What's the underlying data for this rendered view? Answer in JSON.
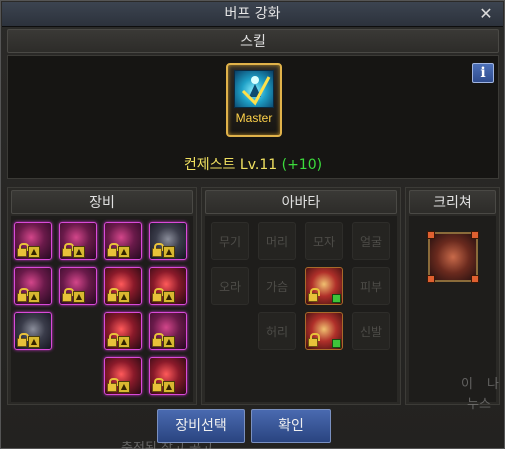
{
  "window": {
    "title": "버프 강화",
    "close_glyph": "✕"
  },
  "skill": {
    "header": "스킬",
    "info_label": "i",
    "icon_name": "buff-skill-icon",
    "badge": "Master",
    "level_text": "컨제스트 Lv.11",
    "level_bonus": "(+10)"
  },
  "equipment": {
    "header": "장비",
    "items": [
      {
        "icon": "armor-icon"
      },
      {
        "icon": "shoulder-icon"
      },
      {
        "icon": "spiked-armor-icon"
      },
      {
        "icon": "dark-armor-icon"
      },
      {
        "icon": "pants-icon"
      },
      {
        "icon": "belt-icon"
      },
      {
        "icon": "orb-icon"
      },
      {
        "icon": "necklace-icon"
      },
      {
        "icon": "boots-icon"
      },
      {
        "icon": "gem-icon"
      },
      {
        "icon": "bracelet-icon"
      },
      {
        "icon": "box-icon"
      },
      {
        "icon": "seal-icon"
      }
    ]
  },
  "avatar": {
    "header": "아바타",
    "slots": [
      "무기",
      "머리",
      "모자",
      "얼굴",
      "오라",
      "가슴",
      "",
      "피부",
      "",
      "허리",
      "",
      "신발"
    ],
    "equipped": [
      "chest-avatar-icon",
      "waist-avatar-icon"
    ]
  },
  "creature": {
    "header": "크리쳐",
    "icon": "creature-icon"
  },
  "footer": {
    "equip_select": "장비선택",
    "confirm": "확인"
  },
  "background_text": {
    "right_1": "이",
    "right_2": "나",
    "right_3": "누스",
    "bottom": "충전된 창고 공고"
  },
  "colors": {
    "title_bar": "#343c48",
    "master_gold": "#e0b24a",
    "level_text": "#f0e060",
    "level_bonus": "#3cdc3c",
    "button_blue": "#3a56a0"
  }
}
